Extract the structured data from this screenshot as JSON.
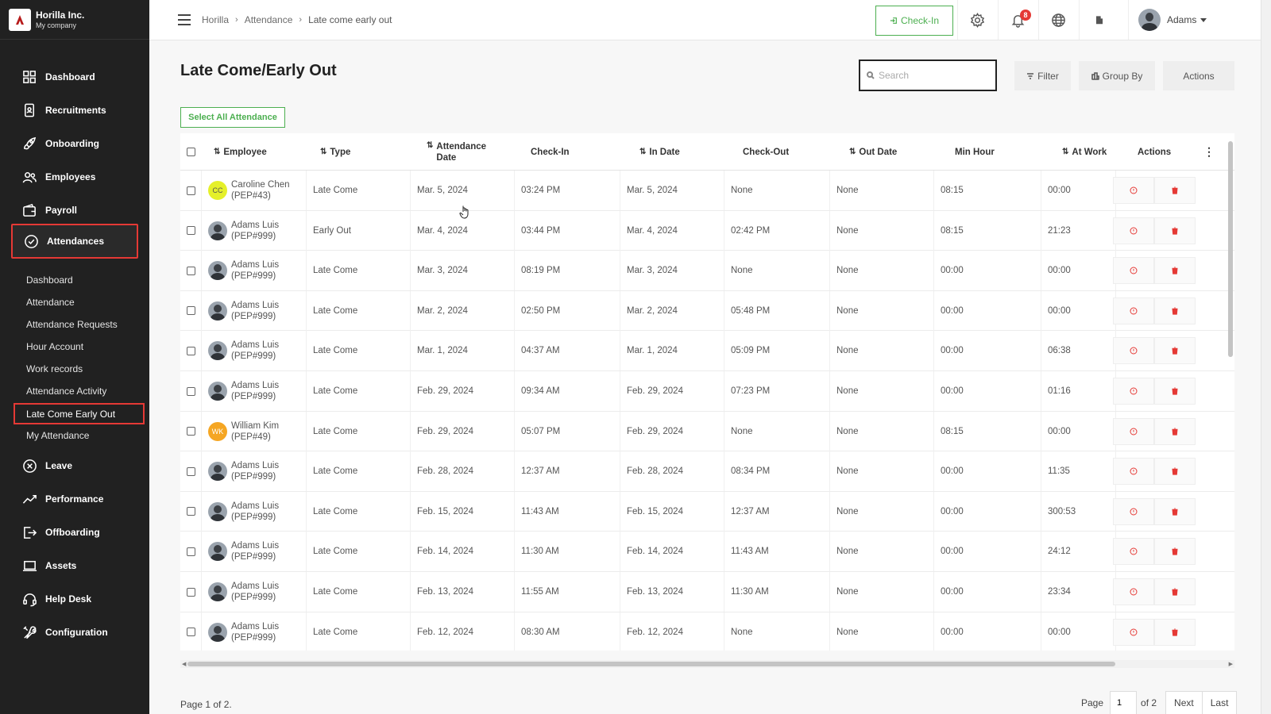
{
  "brand": {
    "name": "Horilla Inc.",
    "sub": "My company"
  },
  "nav": [
    {
      "id": "dashboard",
      "label": "Dashboard",
      "icon": "dashboard-icon"
    },
    {
      "id": "recruitments",
      "label": "Recruitments",
      "icon": "recruitment-icon"
    },
    {
      "id": "onboarding",
      "label": "Onboarding",
      "icon": "rocket-icon"
    },
    {
      "id": "employees",
      "label": "Employees",
      "icon": "people-icon"
    },
    {
      "id": "payroll",
      "label": "Payroll",
      "icon": "wallet-icon"
    },
    {
      "id": "attendances",
      "label": "Attendances",
      "icon": "check-circle-icon"
    },
    {
      "id": "leave",
      "label": "Leave",
      "icon": "leave-icon"
    },
    {
      "id": "performance",
      "label": "Performance",
      "icon": "chart-line-icon"
    },
    {
      "id": "offboarding",
      "label": "Offboarding",
      "icon": "exit-icon"
    },
    {
      "id": "assets",
      "label": "Assets",
      "icon": "laptop-icon"
    },
    {
      "id": "helpdesk",
      "label": "Help Desk",
      "icon": "headset-icon"
    },
    {
      "id": "configuration",
      "label": "Configuration",
      "icon": "tools-icon"
    }
  ],
  "subnav": [
    "Dashboard",
    "Attendance",
    "Attendance Requests",
    "Hour Account",
    "Work records",
    "Attendance Activity",
    "Late Come Early Out",
    "My Attendance"
  ],
  "header": {
    "breadcrumb": [
      "Horilla",
      "Attendance",
      "Late come early out"
    ],
    "checkin_label": "Check-In",
    "notif_count": "8",
    "user_name": "Adams"
  },
  "page": {
    "title": "Late Come/Early Out",
    "search_placeholder": "Search",
    "filter_label": "Filter",
    "groupby_label": "Group By",
    "actions_label": "Actions",
    "select_all_label": "Select All Attendance"
  },
  "table": {
    "headers": {
      "employee": "Employee",
      "type": "Type",
      "attendance_date": "Attendance Date",
      "check_in": "Check-In",
      "in_date": "In Date",
      "check_out": "Check-Out",
      "out_date": "Out Date",
      "min_hour": "Min Hour",
      "at_work": "At Work",
      "actions": "Actions"
    },
    "rows": [
      {
        "name": "Caroline Chen",
        "code": "(PEP#43)",
        "avatar": "CC",
        "avatar_color": "#e5f02a",
        "type": "Late Come",
        "att_date": "Mar. 5, 2024",
        "check_in": "03:24 PM",
        "in_date": "Mar. 5, 2024",
        "check_out": "None",
        "out_date": "None",
        "min_hour": "08:15",
        "at_work": "00:00"
      },
      {
        "name": "Adams Luis",
        "code": "(PEP#999)",
        "avatar": "",
        "avatar_color": "",
        "type": "Early Out",
        "att_date": "Mar. 4, 2024",
        "check_in": "03:44 PM",
        "in_date": "Mar. 4, 2024",
        "check_out": "02:42 PM",
        "out_date": "None",
        "min_hour": "08:15",
        "at_work": "21:23"
      },
      {
        "name": "Adams Luis",
        "code": "(PEP#999)",
        "avatar": "",
        "avatar_color": "",
        "type": "Late Come",
        "att_date": "Mar. 3, 2024",
        "check_in": "08:19 PM",
        "in_date": "Mar. 3, 2024",
        "check_out": "None",
        "out_date": "None",
        "min_hour": "00:00",
        "at_work": "00:00"
      },
      {
        "name": "Adams Luis",
        "code": "(PEP#999)",
        "avatar": "",
        "avatar_color": "",
        "type": "Late Come",
        "att_date": "Mar. 2, 2024",
        "check_in": "02:50 PM",
        "in_date": "Mar. 2, 2024",
        "check_out": "05:48 PM",
        "out_date": "None",
        "min_hour": "00:00",
        "at_work": "00:00"
      },
      {
        "name": "Adams Luis",
        "code": "(PEP#999)",
        "avatar": "",
        "avatar_color": "",
        "type": "Late Come",
        "att_date": "Mar. 1, 2024",
        "check_in": "04:37 AM",
        "in_date": "Mar. 1, 2024",
        "check_out": "05:09 PM",
        "out_date": "None",
        "min_hour": "00:00",
        "at_work": "06:38"
      },
      {
        "name": "Adams Luis",
        "code": "(PEP#999)",
        "avatar": "",
        "avatar_color": "",
        "type": "Late Come",
        "att_date": "Feb. 29, 2024",
        "check_in": "09:34 AM",
        "in_date": "Feb. 29, 2024",
        "check_out": "07:23 PM",
        "out_date": "None",
        "min_hour": "00:00",
        "at_work": "01:16"
      },
      {
        "name": "William Kim",
        "code": "(PEP#49)",
        "avatar": "WK",
        "avatar_color": "#f5a623",
        "type": "Late Come",
        "att_date": "Feb. 29, 2024",
        "check_in": "05:07 PM",
        "in_date": "Feb. 29, 2024",
        "check_out": "None",
        "out_date": "None",
        "min_hour": "08:15",
        "at_work": "00:00"
      },
      {
        "name": "Adams Luis",
        "code": "(PEP#999)",
        "avatar": "",
        "avatar_color": "",
        "type": "Late Come",
        "att_date": "Feb. 28, 2024",
        "check_in": "12:37 AM",
        "in_date": "Feb. 28, 2024",
        "check_out": "08:34 PM",
        "out_date": "None",
        "min_hour": "00:00",
        "at_work": "11:35"
      },
      {
        "name": "Adams Luis",
        "code": "(PEP#999)",
        "avatar": "",
        "avatar_color": "",
        "type": "Late Come",
        "att_date": "Feb. 15, 2024",
        "check_in": "11:43 AM",
        "in_date": "Feb. 15, 2024",
        "check_out": "12:37 AM",
        "out_date": "None",
        "min_hour": "00:00",
        "at_work": "300:53"
      },
      {
        "name": "Adams Luis",
        "code": "(PEP#999)",
        "avatar": "",
        "avatar_color": "",
        "type": "Late Come",
        "att_date": "Feb. 14, 2024",
        "check_in": "11:30 AM",
        "in_date": "Feb. 14, 2024",
        "check_out": "11:43 AM",
        "out_date": "None",
        "min_hour": "00:00",
        "at_work": "24:12"
      },
      {
        "name": "Adams Luis",
        "code": "(PEP#999)",
        "avatar": "",
        "avatar_color": "",
        "type": "Late Come",
        "att_date": "Feb. 13, 2024",
        "check_in": "11:55 AM",
        "in_date": "Feb. 13, 2024",
        "check_out": "11:30 AM",
        "out_date": "None",
        "min_hour": "00:00",
        "at_work": "23:34"
      },
      {
        "name": "Adams Luis",
        "code": "(PEP#999)",
        "avatar": "",
        "avatar_color": "",
        "type": "Late Come",
        "att_date": "Feb. 12, 2024",
        "check_in": "08:30 AM",
        "in_date": "Feb. 12, 2024",
        "check_out": "None",
        "out_date": "None",
        "min_hour": "00:00",
        "at_work": "00:00"
      }
    ]
  },
  "pagination": {
    "summary": "Page 1 of 2.",
    "page_label": "Page",
    "current": "1",
    "of_label": "of 2",
    "next_label": "Next",
    "last_label": "Last"
  },
  "colors": {
    "accent_green": "#4caf50",
    "highlight_red": "#e53935",
    "sidebar_bg": "#212121"
  }
}
